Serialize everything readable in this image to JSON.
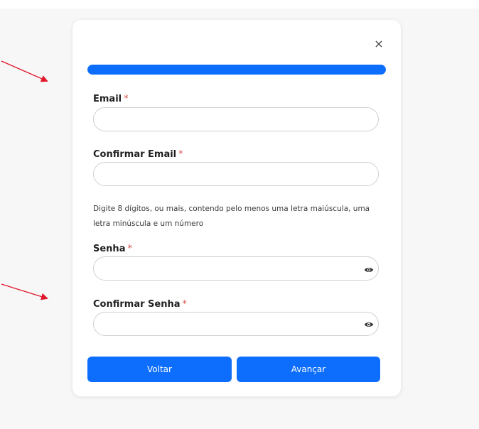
{
  "dialog": {
    "close_glyph": "×",
    "progress": {
      "value": 1.0,
      "color": "#0d6efd"
    }
  },
  "form": {
    "email_label": "Email",
    "confirm_email_label": "Confirmar Email",
    "hint": "Digite 8 dígitos, ou mais, contendo pelo menos uma letra maiúscula, uma letra minúscula e um número",
    "password_label": "Senha",
    "confirm_password_label": "Confirmar Senha",
    "required_marker": "*"
  },
  "actions": {
    "back_label": "Voltar",
    "next_label": "Avançar"
  },
  "colors": {
    "primary": "#0d6efd",
    "required": "#d9534f",
    "annotation_arrow": "#e0192c"
  }
}
